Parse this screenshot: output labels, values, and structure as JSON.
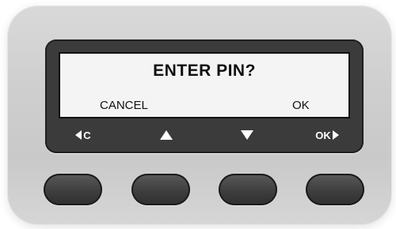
{
  "display": {
    "prompt": "ENTER PIN?",
    "left_option": "CANCEL",
    "right_option": "OK"
  },
  "softkeys": {
    "left": {
      "label": "C",
      "icon": "arrow-left-icon"
    },
    "up": {
      "icon": "arrow-up-icon"
    },
    "down": {
      "icon": "arrow-down-icon"
    },
    "right": {
      "label": "OK",
      "icon": "arrow-right-icon"
    }
  },
  "colors": {
    "device_body": "#cfcfcf",
    "bezel": "#3b3b3b",
    "screen": "#f4f4f4",
    "text": "#111111",
    "key": "#3e3e3e"
  }
}
